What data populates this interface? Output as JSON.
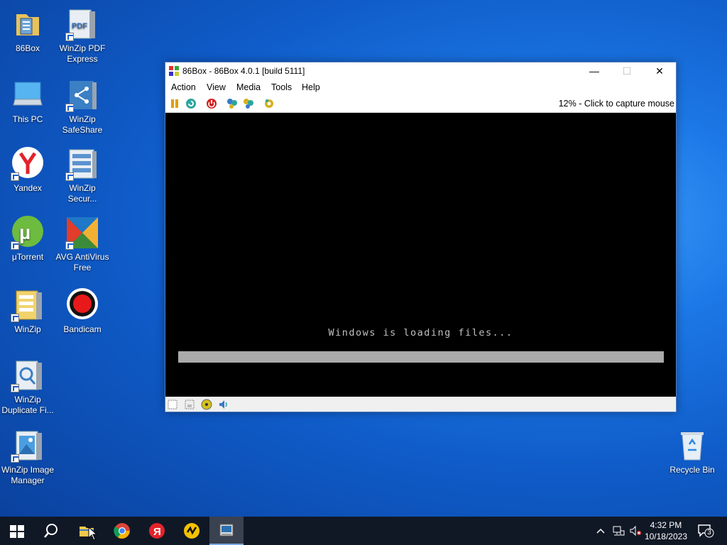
{
  "desktop": {
    "icons": [
      {
        "label": "86Box"
      },
      {
        "label": "WinZip PDF Express"
      },
      {
        "label": "This PC"
      },
      {
        "label": "WinZip SafeShare"
      },
      {
        "label": "Yandex"
      },
      {
        "label": "WinZip Secur..."
      },
      {
        "label": "μTorrent"
      },
      {
        "label": "AVG AntiVirus Free"
      },
      {
        "label": "WinZip"
      },
      {
        "label": "Bandicam"
      },
      {
        "label": "WinZip Duplicate Fi..."
      },
      {
        "label": "WinZip Image Manager"
      },
      {
        "label": "Recycle Bin"
      }
    ]
  },
  "window": {
    "title": "86Box - 86Box 4.0.1 [build 5111]",
    "controls": {
      "minimize": "—",
      "maximize": "☐",
      "close": "✕"
    },
    "menu": [
      "Action",
      "View",
      "Media",
      "Tools",
      "Help"
    ],
    "toolbar_status": "12% - Click to capture mouse",
    "screen": {
      "message": "Windows is loading files...",
      "progress": 1.0
    }
  },
  "taskbar": {
    "time": "4:32 PM",
    "date": "10/18/2023",
    "notifications": "3",
    "apps": [
      "start",
      "search",
      "file-explorer",
      "chrome",
      "yandex",
      "norton",
      "86box"
    ]
  },
  "colors": {
    "accent": "#1c78e6",
    "taskbar": "#101826",
    "screen": "#000000",
    "progress": "#aaaaaa"
  }
}
